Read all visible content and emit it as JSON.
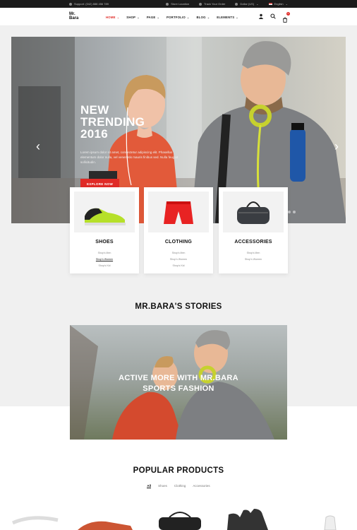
{
  "topbar": {
    "phone": "Support: (042) 888 456 789",
    "store": "Store Location",
    "track": "Track Your Order",
    "currency": "Dollar (US)",
    "language": "English"
  },
  "logo": {
    "line1": "Mr.",
    "line2": "Bara"
  },
  "nav": [
    {
      "label": "HOME",
      "active": true
    },
    {
      "label": "SHOP"
    },
    {
      "label": "PAGE"
    },
    {
      "label": "PORTFOLIO"
    },
    {
      "label": "BLOG"
    },
    {
      "label": "ELEMENTS"
    }
  ],
  "cart": {
    "count": "0"
  },
  "hero": {
    "title_line1": "NEW",
    "title_line2": "TRENDING",
    "title_line3": "2016",
    "text": "Lorem ipsum dolor sit amet, consectetur adipiscing elit. Phasellus elementum dolor nulla, vel venenatis mauris finibus sed. Nulla feugiat sollicitudin.",
    "button": "EXPLORE NOW"
  },
  "categories": [
    {
      "title": "SHOES",
      "links": [
        "Shop's Men",
        "Shop's Women",
        "Shop's Kid"
      ]
    },
    {
      "title": "CLOTHING",
      "links": [
        "Shop's Men",
        "Shop's Women",
        "Shop's Kid"
      ]
    },
    {
      "title": "ACCESSORIES",
      "links": [
        "Shop's Men",
        "Shop's Women"
      ]
    }
  ],
  "stories": {
    "title": "MR.BARA'S STORIES",
    "line1": "ACTIVE MORE WITH MR.BARA",
    "line2": "SPORTS FASHION"
  },
  "popular": {
    "title": "POPULAR PRODUCTS",
    "tabs": [
      "All",
      "Shoes",
      "Clothing",
      "Accessories"
    ]
  },
  "colors": {
    "accent": "#e02b27",
    "topbar": "#1b1b1b",
    "section_bg": "#f0f0f0"
  }
}
